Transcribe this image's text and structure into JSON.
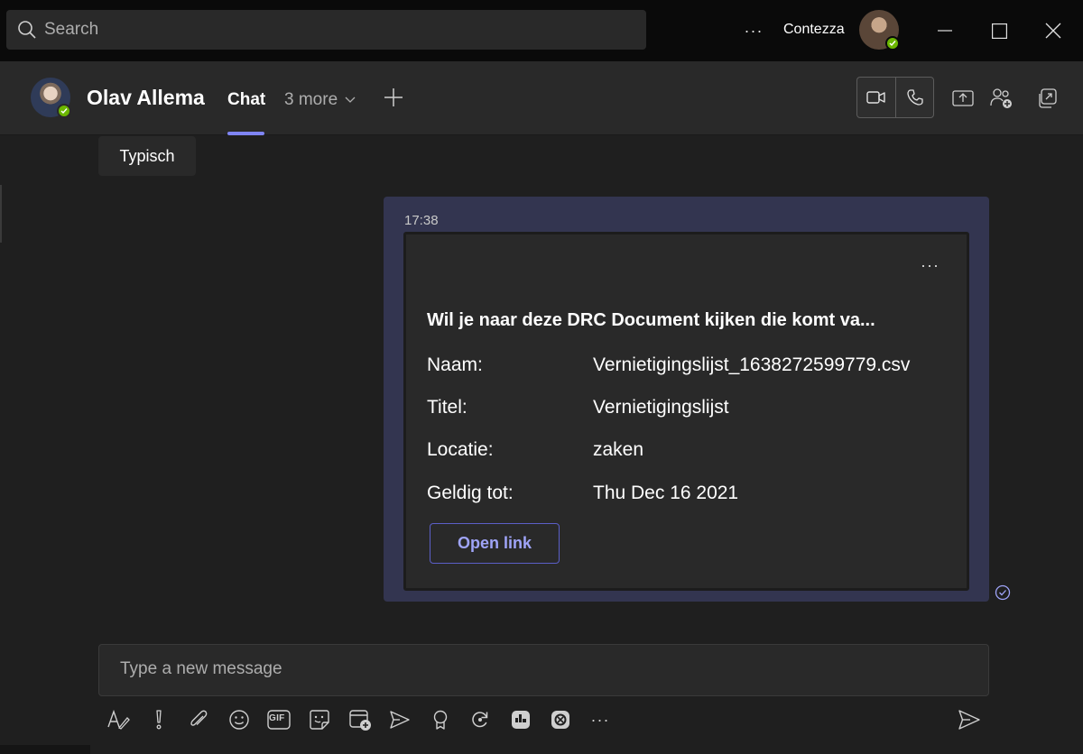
{
  "titlebar": {
    "search_placeholder": "Search",
    "more_label": "···",
    "user_name": "Contezza"
  },
  "header": {
    "contact_name": "Olav Allema",
    "tab_chat": "Chat",
    "tab_more": "3 more"
  },
  "chat": {
    "previous_message": "Typisch",
    "message": {
      "time": "17:38",
      "card": {
        "more_label": "···",
        "title": "Wil je naar deze DRC Document kijken die komt va...",
        "facts": [
          {
            "label": "Naam:",
            "value": "Vernietigingslijst_1638272599779.csv"
          },
          {
            "label": "Titel:",
            "value": "Vernietigingslijst"
          },
          {
            "label": "Locatie:",
            "value": "zaken"
          },
          {
            "label": "Geldig tot:",
            "value": "Thu Dec 16 2021"
          }
        ],
        "action_label": "Open link"
      }
    }
  },
  "compose": {
    "placeholder": "Type a new message",
    "gif_label": "GIF",
    "more_label": "···"
  },
  "colors": {
    "accent": "#7f85f5",
    "bubble": "#333550",
    "presence": "#6bb700",
    "link": "#9fa4f8"
  }
}
